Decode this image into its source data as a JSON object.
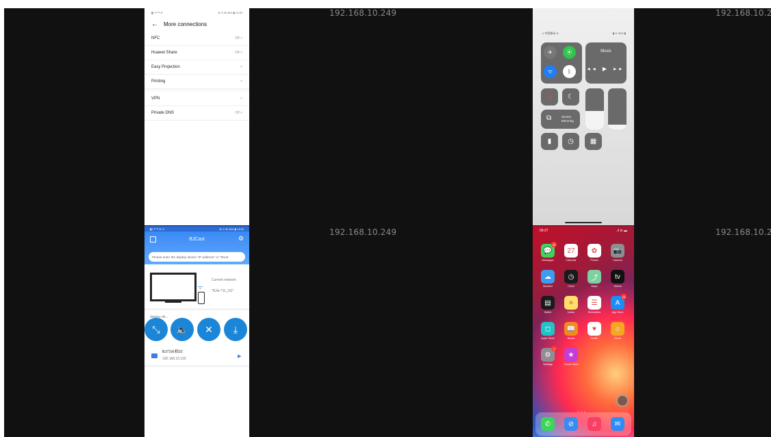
{
  "watermarks": [
    "192.168.10.249",
    "192.168.10.249",
    "192.168.10.24",
    "192.168.10.24"
  ],
  "settings": {
    "status_left": "▮▯ ᵃˡˡ ᵃˡˡ ≋",
    "status_right": "⊕ ⊙ ⏲ 46% ▮ 13:30",
    "title": "More connections",
    "rows": [
      {
        "label": "NFC",
        "value": "Off >"
      },
      {
        "label": "Huawei Share",
        "value": "Off >"
      },
      {
        "label": "Easy Projection",
        "value": ">"
      },
      {
        "label": "Printing",
        "value": ">"
      },
      {
        "label": "VPN",
        "value": ">"
      },
      {
        "label": "Private DNS",
        "value": "Off >"
      }
    ]
  },
  "bjcast": {
    "status_left": "▮▯ ᵃˡˡ ᵃˡˡ ≋ ⊙",
    "status_right": "⊕ ⊙ ⏲ 45% ▮ 13:30",
    "title": "BJCast",
    "search_placeholder": "Please enter the display device \"IP address\" or \"Short",
    "current_network_label": "Current network",
    "ssid": "\"BJie-711_5G\"",
    "list_label": "display de...",
    "device": {
      "name": "BJ72从机02",
      "ip": "192.168.10.155"
    }
  },
  "control_center": {
    "status_left": "..ıl 中国移动 ≋",
    "status_right": "▮ ⊙ 90% ▮",
    "music_label": "Music",
    "music_controls": "◂◂  ▶  ▸▸",
    "mirroring_label": "Screen\nMirroring",
    "brightness_level": 0.45,
    "volume_level": 0.12
  },
  "home": {
    "time": "09:27",
    "status_right": ".ıl ≋ ▬",
    "apps": [
      {
        "label": "Messages",
        "glyph": "💬",
        "color": "#3dd45b",
        "badge": "38"
      },
      {
        "label": "Calendar",
        "glyph": "27",
        "color": "#ffffff",
        "badge": ""
      },
      {
        "label": "Photos",
        "glyph": "✿",
        "color": "#ffffff",
        "badge": ""
      },
      {
        "label": "Camera",
        "glyph": "📷",
        "color": "#8e8e8e",
        "badge": ""
      },
      {
        "label": "Weather",
        "glyph": "☁",
        "color": "#3b9cf0",
        "badge": ""
      },
      {
        "label": "Clock",
        "glyph": "◷",
        "color": "#1a1a1a",
        "badge": ""
      },
      {
        "label": "Maps",
        "glyph": "⤴",
        "color": "#7fd0a0",
        "badge": ""
      },
      {
        "label": "Videos",
        "glyph": "tv",
        "color": "#111111",
        "badge": ""
      },
      {
        "label": "Wallet",
        "glyph": "▤",
        "color": "#1a1a1a",
        "badge": ""
      },
      {
        "label": "Notes",
        "glyph": "≡",
        "color": "#ffe16a",
        "badge": ""
      },
      {
        "label": "Reminders",
        "glyph": "☰",
        "color": "#ffffff",
        "badge": ""
      },
      {
        "label": "App Store",
        "glyph": "A",
        "color": "#1e8ef5",
        "badge": "48"
      },
      {
        "label": "Apple Store",
        "glyph": "◻",
        "color": "#22c3c6",
        "badge": ""
      },
      {
        "label": "Books",
        "glyph": "📖",
        "color": "#f28b1e",
        "badge": ""
      },
      {
        "label": "Health",
        "glyph": "♥",
        "color": "#ffffff",
        "badge": ""
      },
      {
        "label": "Home",
        "glyph": "⌂",
        "color": "#f5a623",
        "badge": ""
      },
      {
        "label": "Settings",
        "glyph": "⚙",
        "color": "#8e8e93",
        "badge": "3"
      },
      {
        "label": "iTunes Store",
        "glyph": "★",
        "color": "#c63cd8",
        "badge": ""
      }
    ],
    "page_dots": "• • •",
    "dock": [
      {
        "name": "Phone",
        "glyph": "✆",
        "color": "#3dd45b"
      },
      {
        "name": "Safari",
        "glyph": "⊘",
        "color": "#3a8af3"
      },
      {
        "name": "Music",
        "glyph": "♫",
        "color": "#fa3f63"
      },
      {
        "name": "Mail",
        "glyph": "✉",
        "color": "#2f8cf5"
      }
    ]
  }
}
